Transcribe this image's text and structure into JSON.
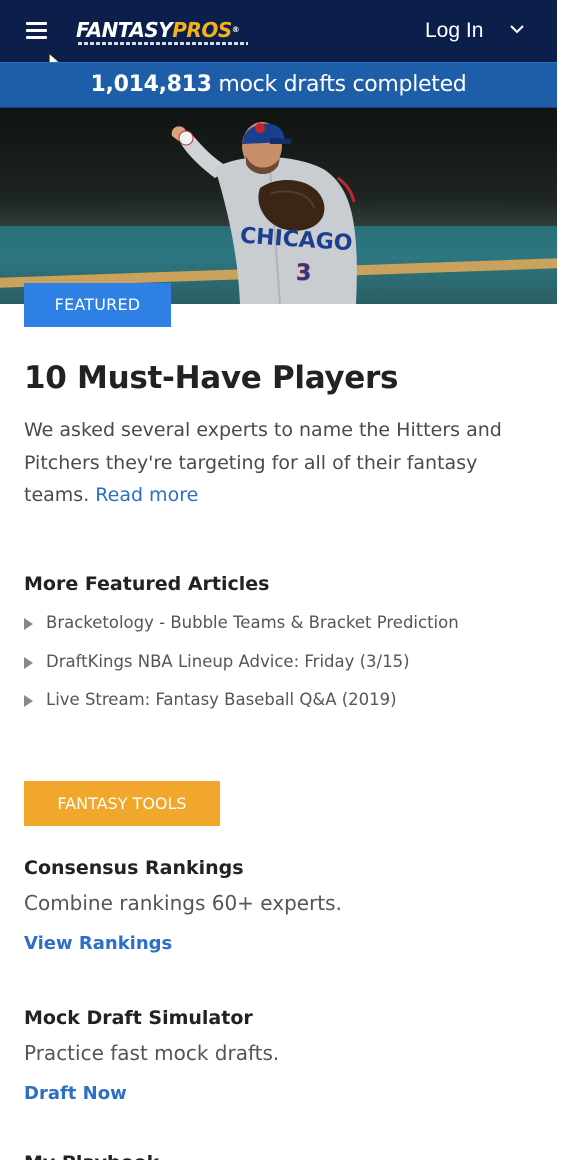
{
  "header": {
    "logo": {
      "part1": "FANTASY",
      "part2": "PROS",
      "reg": "®"
    },
    "login_label": "Log In",
    "icons": {
      "menu": "hamburger-menu-icon",
      "dropdown": "chevron-down-icon",
      "pointer": "mouse-cursor-icon"
    }
  },
  "stats": {
    "count": "1,014,813",
    "label": "mock drafts completed"
  },
  "hero": {
    "image": "baseball-pitcher-photo",
    "jersey_text": "CHICAGO",
    "jersey_number": "3"
  },
  "featured": {
    "badge": "FEATURED",
    "title": "10 Must-Have Players",
    "description": "We asked several experts to name the Hitters and Pitchers they're targeting for all of their fantasy teams.",
    "read_more": "Read more"
  },
  "more_articles": {
    "heading": "More Featured Articles",
    "items": [
      "Bracketology - Bubble Teams & Bracket Prediction",
      "DraftKings NBA Lineup Advice: Friday (3/15)",
      "Live Stream: Fantasy Baseball Q&A (2019)"
    ]
  },
  "tools": {
    "badge": "FANTASY TOOLS",
    "items": [
      {
        "title": "Consensus Rankings",
        "desc": "Combine rankings 60+ experts.",
        "link": "View Rankings"
      },
      {
        "title": "Mock Draft Simulator",
        "desc": "Practice fast mock drafts.",
        "link": "Draft Now"
      },
      {
        "title": "My Playbook",
        "desc": "",
        "link": ""
      }
    ]
  },
  "colors": {
    "header_bg": "#0b1f4a",
    "stat_bar_bg": "#1e5ea8",
    "featured_badge": "#2f80e4",
    "tools_badge": "#f0a72c",
    "link": "#2b6fc7",
    "logo_accent": "#f3b21b"
  }
}
